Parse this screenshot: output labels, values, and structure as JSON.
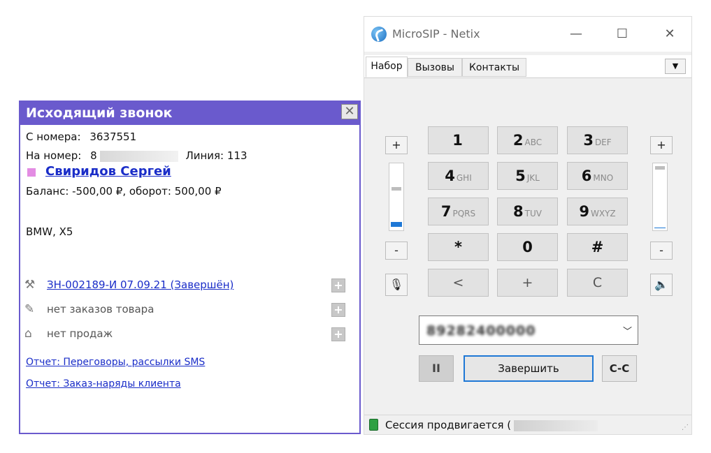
{
  "popup": {
    "title": "Исходящий звонок",
    "close": "✕",
    "from_label": "С номера:",
    "from_value": "3637551",
    "to_label": "На номер:",
    "to_value_visible": "8",
    "line_label": "Линия:",
    "line_value": "113",
    "client_name": "Свиридов Сергей",
    "balance": "Баланс: -500,00 ₽, оборот: 500,00 ₽",
    "car": "BMW, X5",
    "items": [
      {
        "icon": "tools-icon",
        "text": "ЗН-002189-И 07.09.21 (Завершён)",
        "link": true
      },
      {
        "icon": "order-icon",
        "text": "нет заказов товара",
        "link": false
      },
      {
        "icon": "sales-icon",
        "text": "нет продаж",
        "link": false
      }
    ],
    "reports": [
      "Отчет: Переговоры, рассылки SMS",
      "Отчет: Заказ-наряды клиента"
    ]
  },
  "microsip": {
    "title": "MicroSIP - Netix",
    "window_buttons": {
      "minimize": "—",
      "maximize": "☐",
      "close": "✕"
    },
    "tabs": [
      "Набор",
      "Вызовы",
      "Контакты"
    ],
    "active_tab": "Набор",
    "tab_menu": "▼",
    "keypad": [
      {
        "digit": "1",
        "letters": ""
      },
      {
        "digit": "2",
        "letters": "ABC"
      },
      {
        "digit": "3",
        "letters": "DEF"
      },
      {
        "digit": "4",
        "letters": "GHI"
      },
      {
        "digit": "5",
        "letters": "JKL"
      },
      {
        "digit": "6",
        "letters": "MNO"
      },
      {
        "digit": "7",
        "letters": "PQRS"
      },
      {
        "digit": "8",
        "letters": "TUV"
      },
      {
        "digit": "9",
        "letters": "WXYZ"
      },
      {
        "digit": "*",
        "letters": ""
      },
      {
        "digit": "0",
        "letters": ""
      },
      {
        "digit": "#",
        "letters": ""
      }
    ],
    "bottom_keys": [
      "<",
      "+",
      "C"
    ],
    "vol_plus": "+",
    "vol_minus": "-",
    "mic_level": 0.1,
    "speaker_level": 0.0,
    "number_field": "89282400000",
    "hold_label": "II",
    "end_label": "Завершить",
    "transfer_label": "C-C",
    "status": "Сессия продвигается ("
  },
  "colors": {
    "popup_accent": "#6a5acd",
    "link": "#1a2dc8",
    "focus_blue": "#1e78d6"
  }
}
